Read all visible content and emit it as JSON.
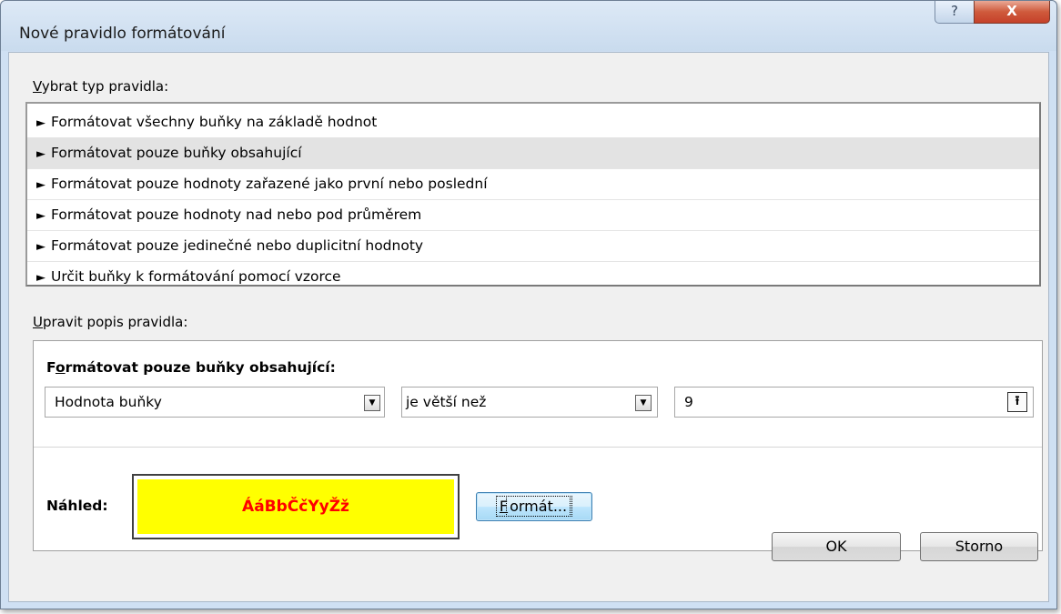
{
  "window": {
    "title": "Nové pravidlo formátování",
    "help_label": "?",
    "close_label": "X"
  },
  "rule_type": {
    "label_prefix": "V",
    "label_rest": "ybrat typ pravidla:",
    "items": [
      {
        "label": "Formátovat všechny buňky na základě hodnot",
        "selected": false
      },
      {
        "label": "Formátovat pouze buňky obsahující",
        "selected": true
      },
      {
        "label": "Formátovat pouze hodnoty zařazené jako první nebo poslední",
        "selected": false
      },
      {
        "label": "Formátovat pouze hodnoty nad nebo pod průměrem",
        "selected": false
      },
      {
        "label": "Formátovat pouze jedinečné nebo duplicitní hodnoty",
        "selected": false
      },
      {
        "label": "Určit buňky k formátování pomocí vzorce",
        "selected": false
      }
    ],
    "arrow_glyph": "►"
  },
  "description": {
    "label_prefix": "U",
    "label_rest": "pravit popis pravidla:",
    "title_pre": "F",
    "title_underlined": "o",
    "title_post": "rmátovat pouze buňky obsahující:",
    "combo1_value": "Hodnota buňky",
    "combo2_value": "je větší než",
    "value": "9",
    "dropdown_glyph": "▼",
    "upload_glyph": "⭱"
  },
  "preview": {
    "label": "Náhled:",
    "sample_text": "ÁáBbČčYyŽž",
    "fill_color": "#ffff00",
    "text_color": "#ff0000"
  },
  "buttons": {
    "format_underlined": "F",
    "format_rest": "ormát...",
    "ok": "OK",
    "cancel": "Storno"
  }
}
